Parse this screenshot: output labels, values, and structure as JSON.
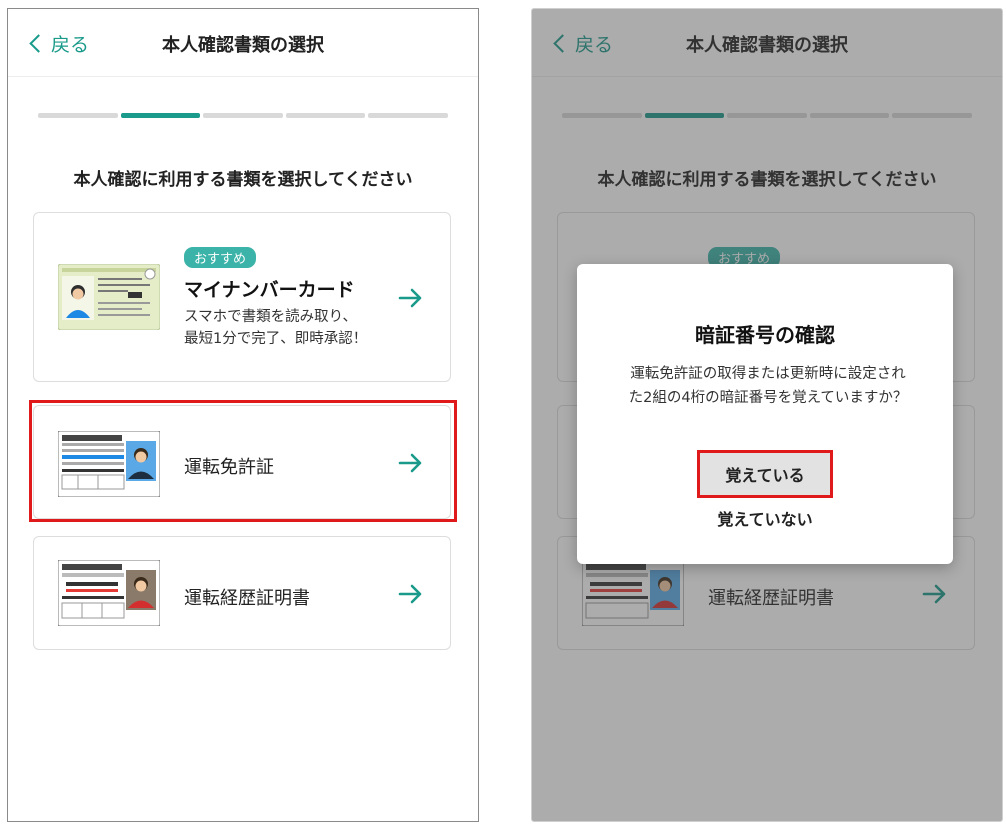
{
  "header": {
    "back_label": "戻る",
    "title": "本人確認書類の選択"
  },
  "progress": {
    "total_steps": 5,
    "current_step": 2
  },
  "instruction": "本人確認に利用する書類を選択してください",
  "documents": [
    {
      "badge": "おすすめ",
      "title": "マイナンバーカード",
      "desc1": "スマホで書類を読み取り、",
      "desc2": "最短1分で完了、即時承認！"
    },
    {
      "title": "運転免許証",
      "selected": true
    },
    {
      "title": "運転経歴証明書"
    }
  ],
  "dialog": {
    "title": "暗証番号の確認",
    "body1": "運転免許証の取得または更新時に設定され",
    "body2": "た2組の4桁の暗証番号を覚えていますか？",
    "yes": "覚えている",
    "no": "覚えていない"
  },
  "colors": {
    "accent": "#1a9a8a",
    "highlight": "#e0191b",
    "badge": "#3bb3a8"
  },
  "icons": [
    "back-chevron-icon",
    "arrow-right-icon",
    "mynumber-card-image",
    "drivers-license-image",
    "driving-history-certificate-image"
  ]
}
